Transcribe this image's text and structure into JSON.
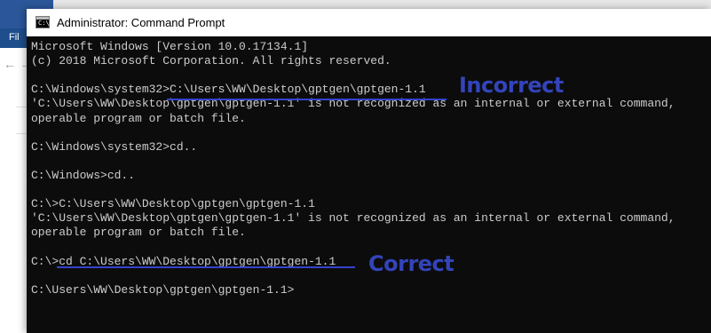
{
  "background_window": {
    "menu_label": "Fil",
    "back_arrow": "←",
    "forward_arrow": "→"
  },
  "window": {
    "title": "Administrator: Command Prompt",
    "icon": "cmd-icon",
    "icon_text": "C:\\"
  },
  "console": {
    "lines": [
      {
        "prompt": "",
        "text": "Microsoft Windows [Version 10.0.17134.1]"
      },
      {
        "prompt": "",
        "text": "(c) 2018 Microsoft Corporation. All rights reserved."
      },
      {
        "prompt": "",
        "text": ""
      },
      {
        "prompt": "C:\\Windows\\system32>",
        "text": "C:\\Users\\WW\\Desktop\\gptgen\\gptgen-1.1"
      },
      {
        "prompt": "",
        "text": "'C:\\Users\\WW\\Desktop\\gptgen\\gptgen-1.1' is not recognized as an internal or external command,"
      },
      {
        "prompt": "",
        "text": "operable program or batch file."
      },
      {
        "prompt": "",
        "text": ""
      },
      {
        "prompt": "C:\\Windows\\system32>",
        "text": "cd.."
      },
      {
        "prompt": "",
        "text": ""
      },
      {
        "prompt": "C:\\Windows>",
        "text": "cd.."
      },
      {
        "prompt": "",
        "text": ""
      },
      {
        "prompt": "C:\\>",
        "text": "C:\\Users\\WW\\Desktop\\gptgen\\gptgen-1.1"
      },
      {
        "prompt": "",
        "text": "'C:\\Users\\WW\\Desktop\\gptgen\\gptgen-1.1' is not recognized as an internal or external command,"
      },
      {
        "prompt": "",
        "text": "operable program or batch file."
      },
      {
        "prompt": "",
        "text": ""
      },
      {
        "prompt": "C:\\>",
        "text": "cd C:\\Users\\WW\\Desktop\\gptgen\\gptgen-1.1"
      },
      {
        "prompt": "",
        "text": ""
      },
      {
        "prompt": "C:\\Users\\WW\\Desktop\\gptgen\\gptgen-1.1>",
        "text": ""
      }
    ]
  },
  "annotations": {
    "incorrect_label": "Incorrect",
    "correct_label": "Correct",
    "color": "#3344bb"
  },
  "colors": {
    "console_bg": "#0c0c0c",
    "console_fg": "#cccccc",
    "titlebar_bg": "#ffffff"
  }
}
